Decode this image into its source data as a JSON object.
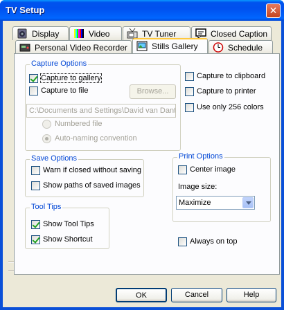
{
  "window": {
    "title": "TV Setup",
    "close_glyph": "✕"
  },
  "tabs_back": [
    {
      "label": "Display",
      "icon": "speaker-icon"
    },
    {
      "label": "Video",
      "icon": "color-bars-icon"
    },
    {
      "label": "TV Tuner",
      "icon": "tuner-icon"
    },
    {
      "label": "Closed Caption",
      "icon": "caption-icon"
    }
  ],
  "tabs_front": [
    {
      "label": "Personal Video Recorder",
      "icon": "recorder-icon"
    },
    {
      "label": "Stills Gallery",
      "icon": "gallery-icon",
      "active": true
    },
    {
      "label": "Schedule",
      "icon": "schedule-icon"
    }
  ],
  "capture": {
    "legend": "Capture Options",
    "gallery_label": "Capture to gallery",
    "gallery_checked": true,
    "file_label": "Capture to file",
    "file_checked": false,
    "browse_label": "Browse...",
    "path_value": "C:\\Documents and Settings\\David van Dant",
    "numbered_label": "Numbered file",
    "autonaming_label": "Auto-naming convention",
    "clipboard_label": "Capture to clipboard",
    "printer_label": "Capture to printer",
    "colors_label": "Use only 256 colors"
  },
  "save": {
    "legend": "Save Options",
    "warn_label": "Warn if closed without saving",
    "paths_label": "Show paths of saved images"
  },
  "print": {
    "legend": "Print Options",
    "center_label": "Center image",
    "size_label": "Image size:",
    "size_value": "Maximize"
  },
  "tooltips": {
    "legend": "Tool Tips",
    "show_tips_label": "Show Tool Tips",
    "show_shortcut_label": "Show Shortcut"
  },
  "always_on_top_label": "Always on top",
  "buttons": {
    "ok": "OK",
    "cancel": "Cancel",
    "help": "Help"
  }
}
